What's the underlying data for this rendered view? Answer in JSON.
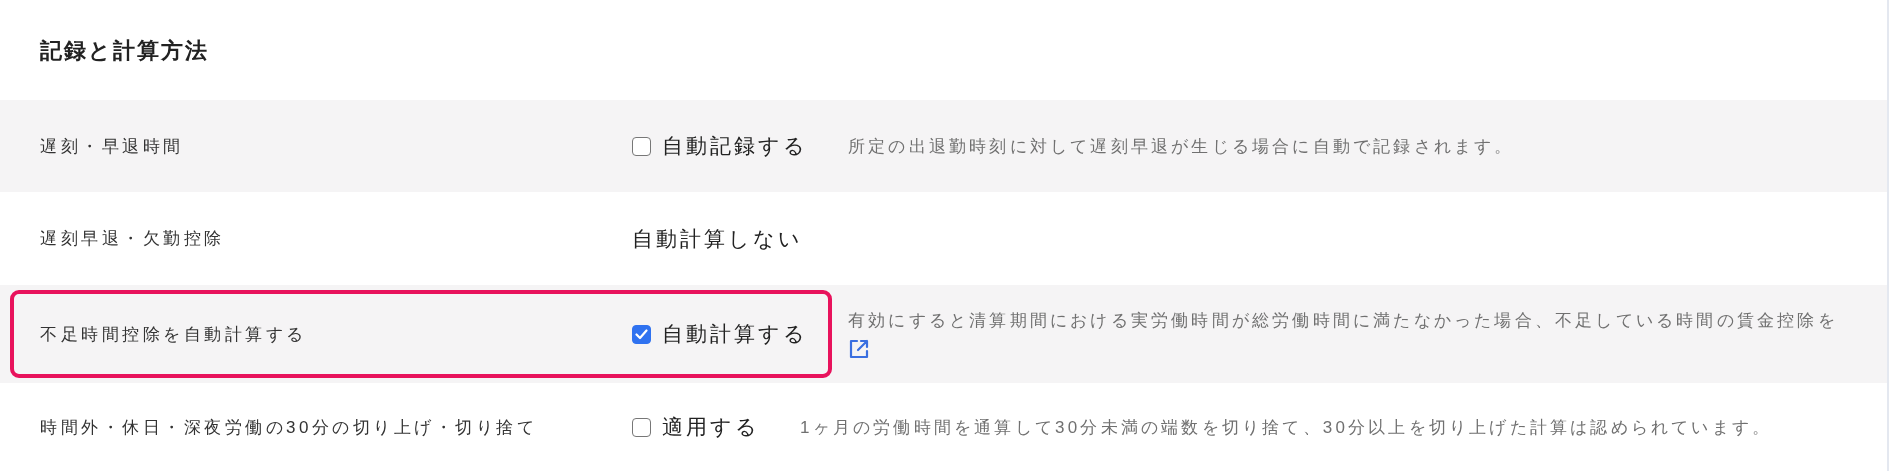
{
  "section_title": "記録と計算方法",
  "rows": [
    {
      "label": "遅刻・早退時間",
      "kind": "checkbox",
      "checked": false,
      "control_label": "自動記録する",
      "description": "所定の出退勤時刻に対して遅刻早退が生じる場合に自動で記録されます。",
      "link": false,
      "highlighted": false
    },
    {
      "label": "遅刻早退・欠勤控除",
      "kind": "text",
      "control_label": "自動計算しない",
      "link": false,
      "highlighted": false
    },
    {
      "label": "不足時間控除を自動計算する",
      "kind": "checkbox",
      "checked": true,
      "control_label": "自動計算する",
      "description": "有効にすると清算期間における実労働時間が総労働時間に満たなかった場合、不足している時間の賃金控除を",
      "link": true,
      "highlighted": true
    },
    {
      "label": "時間外・休日・深夜労働の30分の切り上げ・切り捨て",
      "kind": "checkbox",
      "checked": false,
      "control_label": "適用する",
      "description": "1ヶ月の労働時間を通算して30分未満の端数を切り捨て、30分以上を切り上げた計算は認められています。",
      "link": false,
      "highlighted": false
    }
  ]
}
